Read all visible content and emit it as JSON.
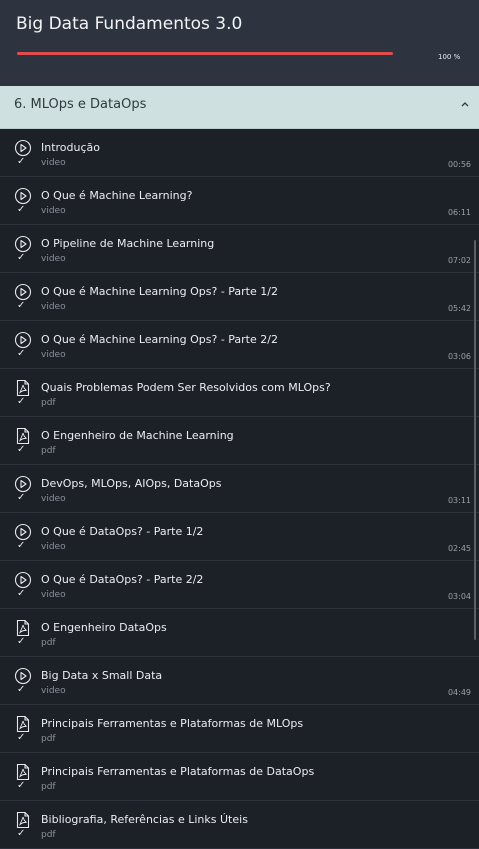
{
  "course": {
    "title": "Big Data Fundamentos 3.0",
    "progress_label": "100 %",
    "progress": 1.0
  },
  "section": {
    "title": "6. MLOps e DataOps"
  },
  "items": [
    {
      "title": "Introdução",
      "type": "video",
      "duration": "00:56",
      "icon": "play-circle-icon",
      "completed": true
    },
    {
      "title": "O Que é Machine Learning?",
      "type": "video",
      "duration": "06:11",
      "icon": "play-circle-icon",
      "completed": true
    },
    {
      "title": "O Pipeline de Machine Learning",
      "type": "video",
      "duration": "07:02",
      "icon": "play-circle-icon",
      "completed": true
    },
    {
      "title": "O Que é Machine Learning Ops? - Parte 1/2",
      "type": "video",
      "duration": "05:42",
      "icon": "play-circle-icon",
      "completed": true
    },
    {
      "title": "O Que é Machine Learning Ops? - Parte 2/2",
      "type": "video",
      "duration": "03:06",
      "icon": "play-circle-icon",
      "completed": true
    },
    {
      "title": "Quais Problemas Podem Ser Resolvidos com MLOps?",
      "type": "pdf",
      "duration": "",
      "icon": "pdf-icon",
      "completed": true
    },
    {
      "title": "O Engenheiro de Machine Learning",
      "type": "pdf",
      "duration": "",
      "icon": "pdf-icon",
      "completed": true
    },
    {
      "title": "DevOps, MLOps, AIOps, DataOps",
      "type": "video",
      "duration": "03:11",
      "icon": "play-circle-icon",
      "completed": true
    },
    {
      "title": "O Que é DataOps? - Parte 1/2",
      "type": "video",
      "duration": "02:45",
      "icon": "play-circle-icon",
      "completed": true
    },
    {
      "title": "O Que é DataOps? - Parte 2/2",
      "type": "video",
      "duration": "03:04",
      "icon": "play-circle-icon",
      "completed": true
    },
    {
      "title": "O Engenheiro DataOps",
      "type": "pdf",
      "duration": "",
      "icon": "pdf-icon",
      "completed": true
    },
    {
      "title": "Big Data x Small Data",
      "type": "video",
      "duration": "04:49",
      "icon": "play-circle-icon",
      "completed": true
    },
    {
      "title": "Principais Ferramentas e Plataformas de MLOps",
      "type": "pdf",
      "duration": "",
      "icon": "pdf-icon",
      "completed": true
    },
    {
      "title": "Principais Ferramentas e Plataformas de DataOps",
      "type": "pdf",
      "duration": "",
      "icon": "pdf-icon",
      "completed": true
    },
    {
      "title": "Bibliografia, Referências e Links Úteis",
      "type": "pdf",
      "duration": "",
      "icon": "pdf-icon",
      "completed": true
    }
  ],
  "colors": {
    "accent": "#e14b4b",
    "section_bg": "#cfe0e1",
    "header_bg": "#2d3440",
    "list_bg": "#1c2027"
  }
}
